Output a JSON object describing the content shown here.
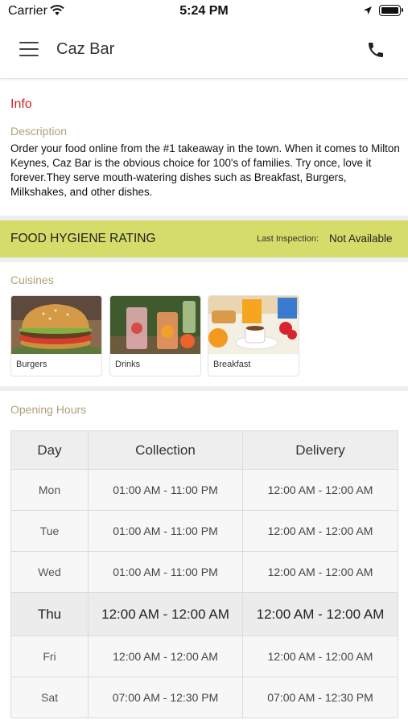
{
  "status_bar": {
    "carrier": "Carrier",
    "time": "5:24 PM"
  },
  "header": {
    "title": "Caz Bar",
    "menu_icon": "hamburger-menu-icon",
    "phone_icon": "phone-icon"
  },
  "info": {
    "title": "Info",
    "description_label": "Description",
    "description": "Order your food online from the #1 takeaway in the town. When it comes to Milton Keynes, Caz Bar is the obvious choice for 100's of families. Try once, love it forever.They serve mouth-watering dishes such as Breakfast, Burgers, Milkshakes,  and other dishes."
  },
  "hygiene": {
    "title": "FOOD HYGIENE RATING",
    "inspection_label": "Last Inspection:",
    "inspection_value": "Not Available"
  },
  "cuisines": {
    "label": "Cuisines",
    "items": [
      {
        "name": "Burgers"
      },
      {
        "name": "Drinks"
      },
      {
        "name": "Breakfast"
      }
    ]
  },
  "opening_hours": {
    "label": "Opening Hours",
    "headers": [
      "Day",
      "Collection",
      "Delivery"
    ],
    "rows": [
      {
        "day": "Mon",
        "collection": "01:00 AM - 11:00 PM",
        "delivery": "12:00 AM - 12:00 AM"
      },
      {
        "day": "Tue",
        "collection": "01:00 AM - 11:00 PM",
        "delivery": "12:00 AM - 12:00 AM"
      },
      {
        "day": "Wed",
        "collection": "01:00 AM - 11:00 PM",
        "delivery": "12:00 AM - 12:00 AM"
      },
      {
        "day": "Thu",
        "collection": "12:00 AM - 12:00 AM",
        "delivery": "12:00 AM - 12:00 AM"
      },
      {
        "day": "Fri",
        "collection": "12:00 AM - 12:00 AM",
        "delivery": "12:00 AM - 12:00 AM"
      },
      {
        "day": "Sat",
        "collection": "07:00 AM - 12:30 PM",
        "delivery": "07:00 AM - 12:30 PM"
      }
    ]
  },
  "colors": {
    "accent_red": "#d2252a",
    "label_tan": "#b3a078",
    "hygiene_bar": "#d6dc6a"
  }
}
